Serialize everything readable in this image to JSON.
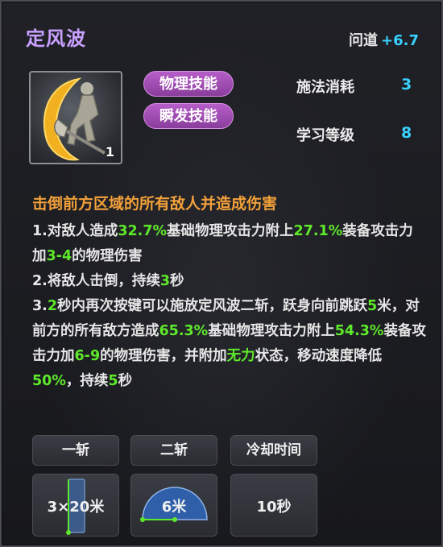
{
  "skill": {
    "name": "定风波",
    "wendao_label": "问道",
    "wendao_value": "+6.7",
    "icon": "crescent-axe-warrior-icon",
    "icon_count": "1",
    "tags": [
      "物理技能",
      "瞬发技能"
    ],
    "cast_cost_label": "施法消耗",
    "cast_cost_value": "3",
    "learn_level_label": "学习等级",
    "learn_level_value": "8"
  },
  "description": {
    "headline": "击倒前方区域的所有敌人并造成伤害",
    "line1": [
      {
        "t": "1.对敌人造成",
        "c": "w"
      },
      {
        "t": "32.7%",
        "c": "g"
      },
      {
        "t": "基础物理攻击力附上",
        "c": "w"
      },
      {
        "t": "27.1%",
        "c": "g"
      },
      {
        "t": "装备攻击力加",
        "c": "w"
      },
      {
        "t": "3-4",
        "c": "g"
      },
      {
        "t": "的物理伤害",
        "c": "w"
      }
    ],
    "line2": [
      {
        "t": "2.将敌人击倒，持续",
        "c": "w"
      },
      {
        "t": "3",
        "c": "g"
      },
      {
        "t": "秒",
        "c": "w"
      }
    ],
    "line3": [
      {
        "t": "3.",
        "c": "w"
      },
      {
        "t": "2",
        "c": "g"
      },
      {
        "t": "秒内再次按键可以施放定风波二斩，跃身向前跳跃",
        "c": "w"
      },
      {
        "t": "5",
        "c": "g"
      },
      {
        "t": "米，对前方的所有敌方造成",
        "c": "w"
      },
      {
        "t": "65.3%",
        "c": "g"
      },
      {
        "t": "基础物理攻击力附上",
        "c": "w"
      },
      {
        "t": "54.3%",
        "c": "g"
      },
      {
        "t": "装备攻击力加",
        "c": "w"
      },
      {
        "t": "6-9",
        "c": "g"
      },
      {
        "t": "的物理伤害，并附加",
        "c": "w"
      },
      {
        "t": "无力",
        "c": "g"
      },
      {
        "t": "状态，移动速度降低",
        "c": "w"
      },
      {
        "t": "50%",
        "c": "g"
      },
      {
        "t": "，持续",
        "c": "w"
      },
      {
        "t": "5",
        "c": "g"
      },
      {
        "t": "秒",
        "c": "w"
      }
    ]
  },
  "ranges": {
    "headers": [
      "一斩",
      "二斩",
      "冷却时间"
    ],
    "values": [
      "3×20米",
      "6米",
      "10秒"
    ],
    "icons": [
      "rectangle-range-icon",
      "semicircle-range-icon"
    ]
  },
  "colors": {
    "title": "#c8a0ff",
    "accent_blue": "#39d1ff",
    "highlight_green": "#5ee82a",
    "headline_orange": "#f2a03a",
    "tag_purple": "#a14fb4"
  }
}
